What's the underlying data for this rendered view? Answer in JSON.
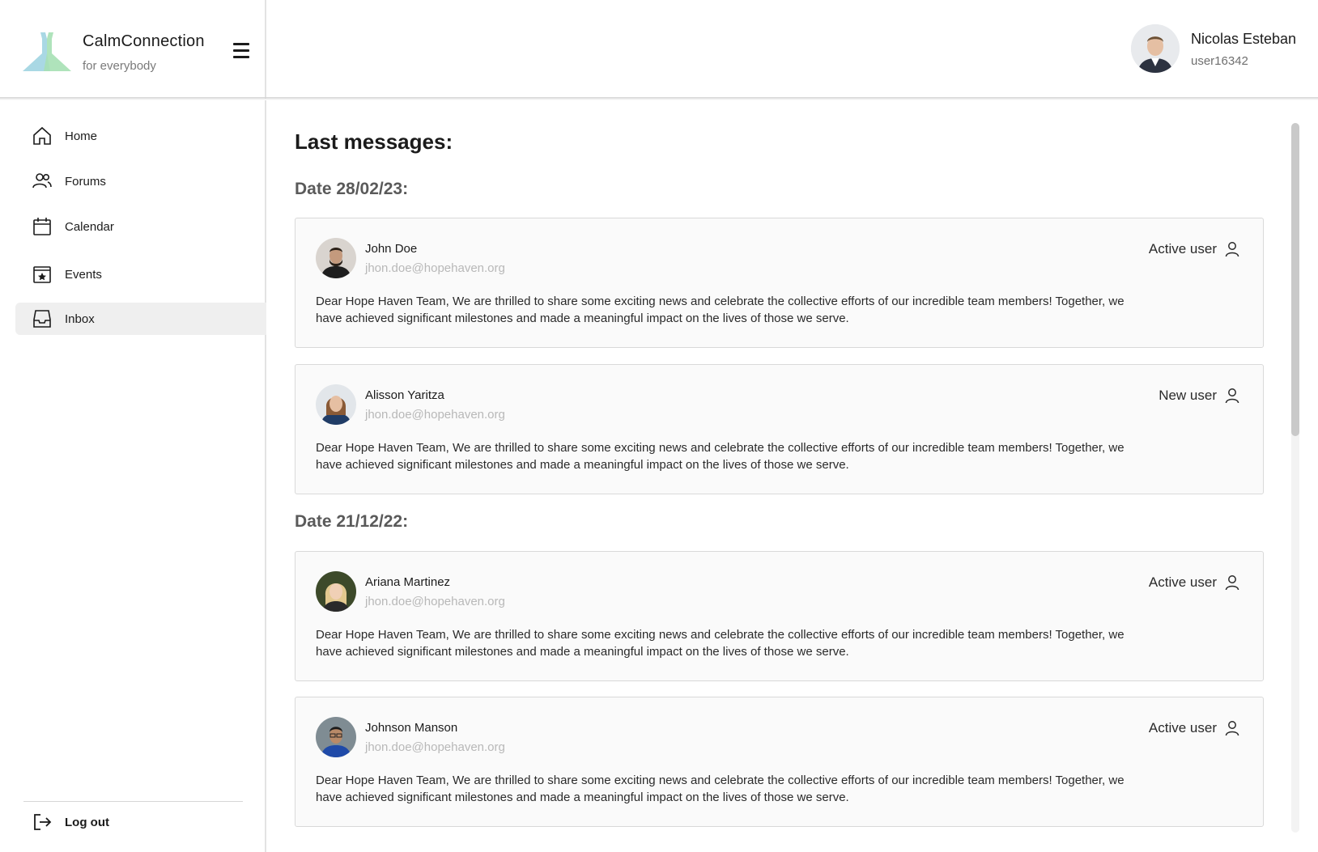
{
  "brand": {
    "name": "CalmConnection",
    "tagline": "for everybody"
  },
  "user": {
    "name": "Nicolas Esteban",
    "id": "user16342"
  },
  "nav": {
    "items": [
      {
        "label": "Home",
        "icon": "home-icon"
      },
      {
        "label": "Forums",
        "icon": "users-icon"
      },
      {
        "label": "Calendar",
        "icon": "calendar-icon"
      },
      {
        "label": "Events",
        "icon": "event-star-icon"
      },
      {
        "label": "Inbox",
        "icon": "inbox-icon",
        "active": true
      }
    ],
    "logout_label": "Log out"
  },
  "main": {
    "title": "Last messages:",
    "groups": [
      {
        "date": "Date 28/02/23:",
        "messages": [
          {
            "name": "John Doe",
            "email": "jhon.doe@hopehaven.org",
            "status": "Active user",
            "text": "Dear Hope Haven Team, We are thrilled to share some exciting news and celebrate the collective efforts of our incredible team members! Together, we have achieved significant milestones and made a meaningful impact on the lives of those we serve."
          },
          {
            "name": "Alisson Yaritza",
            "email": "jhon.doe@hopehaven.org",
            "status": "New user",
            "text": "Dear Hope Haven Team, We are thrilled to share some exciting news and celebrate the collective efforts of our incredible team members! Together, we have achieved significant milestones and made a meaningful impact on the lives of those we serve."
          }
        ]
      },
      {
        "date": "Date 21/12/22:",
        "messages": [
          {
            "name": "Ariana Martinez",
            "email": "jhon.doe@hopehaven.org",
            "status": "Active user",
            "text": "Dear Hope Haven Team, We are thrilled to share some exciting news and celebrate the collective efforts of our incredible team members! Together, we have achieved significant milestones and made a meaningful impact on the lives of those we serve."
          },
          {
            "name": "Johnson Manson",
            "email": "jhon.doe@hopehaven.org",
            "status": "Active user",
            "text": "Dear Hope Haven Team, We are thrilled to share some exciting news and celebrate the collective efforts of our incredible team members! Together, we have achieved significant milestones and made a meaningful impact on the lives of those we serve."
          }
        ]
      }
    ]
  },
  "colors": {
    "active_nav_bg": "#efefef",
    "card_bg": "#fafafa",
    "card_border": "#d9d9d9",
    "email_text": "#b8b8b8"
  }
}
